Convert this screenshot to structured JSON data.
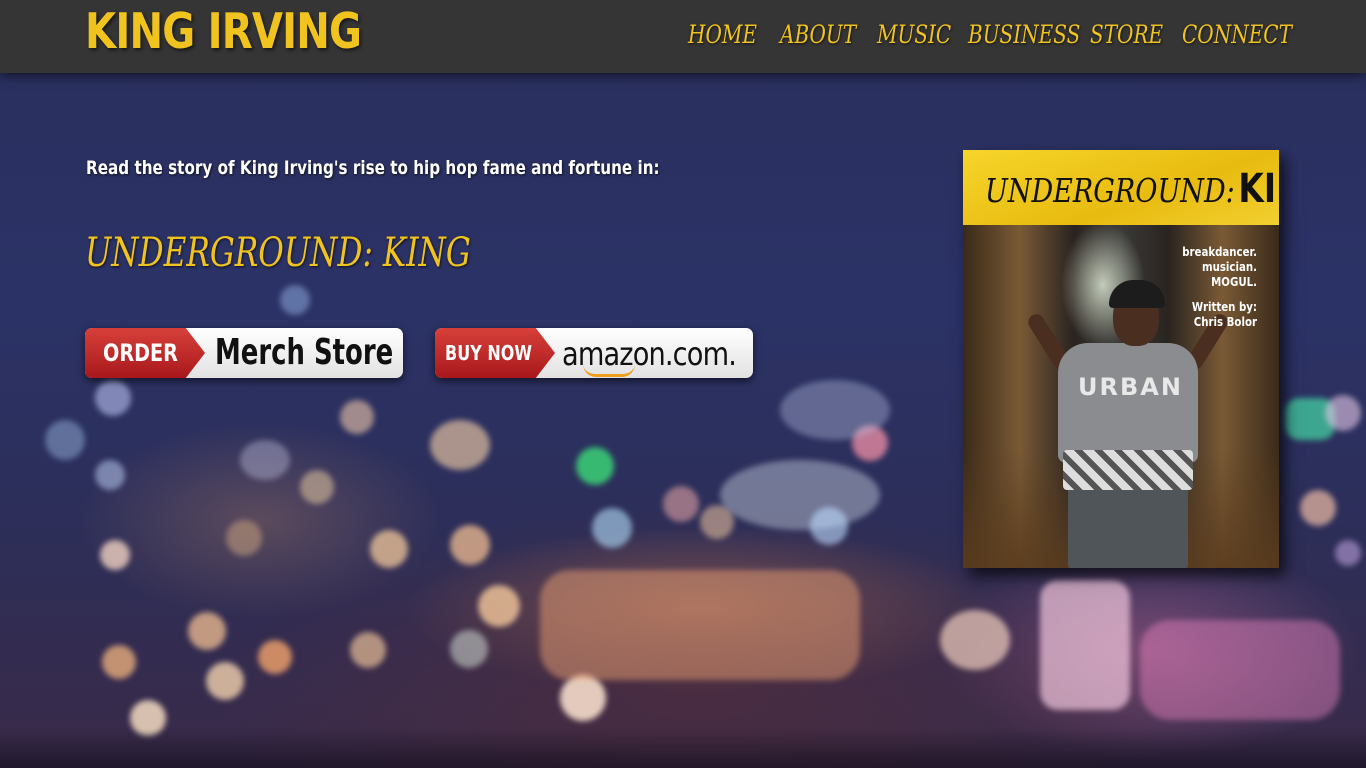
{
  "site": {
    "brand": "KING IRVING"
  },
  "nav": {
    "items": [
      {
        "label": "HOME"
      },
      {
        "label": "ABOUT"
      },
      {
        "label": "MUSIC"
      },
      {
        "label": "BUSINESS"
      },
      {
        "label": "STORE"
      },
      {
        "label": "CONNECT"
      }
    ]
  },
  "content": {
    "intro": "Read the story of King Irving's rise to hip hop fame and fortune in:",
    "book_title": "UNDERGROUND: KING"
  },
  "buttons": {
    "merch": {
      "tag": "ORDER",
      "label": "Merch Store"
    },
    "amazon": {
      "tag": "BUY NOW",
      "label": "amazon.com."
    }
  },
  "book_cover": {
    "title_part1": "UNDERGROUND:",
    "title_part2": "KING",
    "tagline_1": "breakdancer.",
    "tagline_2": "musician.",
    "tagline_3": "MOGUL.",
    "credit_1": "Written by:",
    "credit_2": "Chris Bolor",
    "shirt_text": "URBAN"
  },
  "colors": {
    "accent": "#f0c31e",
    "header_bg": "#353535",
    "button_red": "#c0282a"
  }
}
